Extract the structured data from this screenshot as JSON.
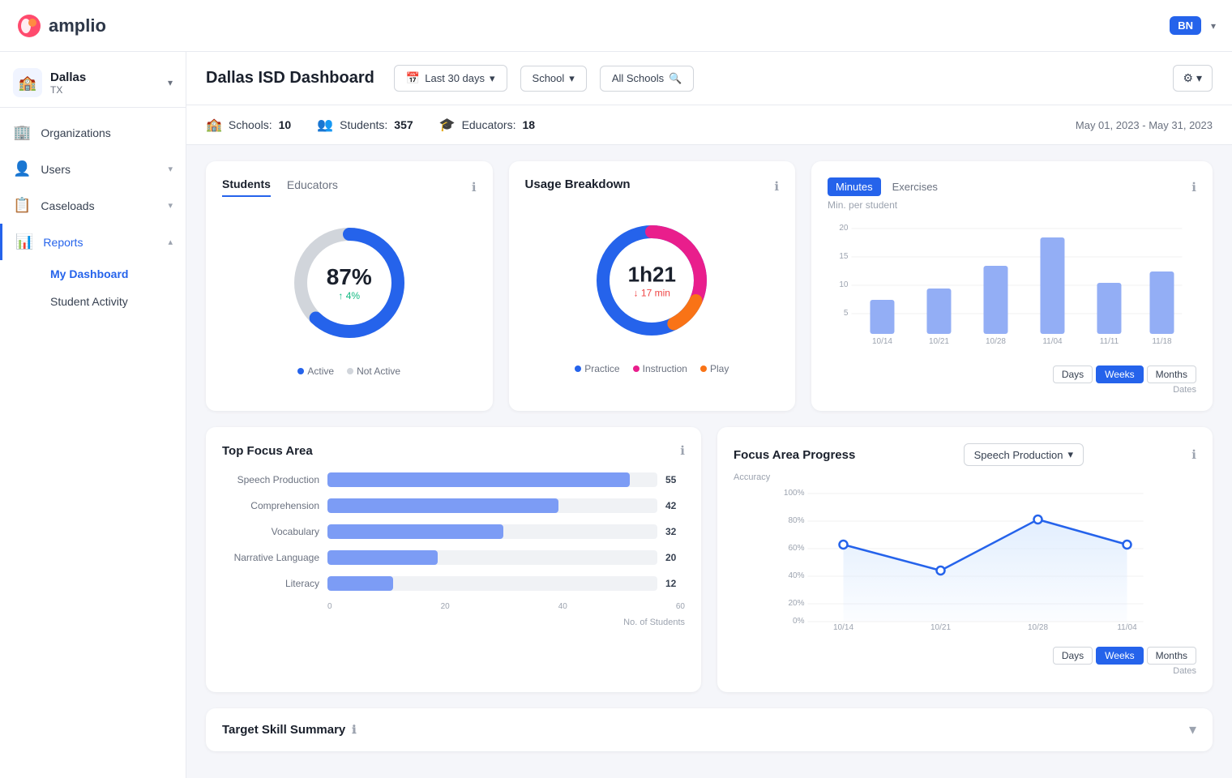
{
  "header": {
    "logo_text": "amplio",
    "user_initials": "BN"
  },
  "sidebar": {
    "district": {
      "name": "Dallas",
      "state": "TX"
    },
    "nav_items": [
      {
        "id": "organizations",
        "label": "Organizations",
        "icon": "🏢",
        "active": false
      },
      {
        "id": "users",
        "label": "Users",
        "icon": "👤",
        "has_sub": true,
        "active": false
      },
      {
        "id": "caseloads",
        "label": "Caseloads",
        "icon": "📋",
        "has_sub": true,
        "active": false
      },
      {
        "id": "reports",
        "label": "Reports",
        "icon": "📊",
        "has_sub": true,
        "active": true
      }
    ],
    "reports_sub": [
      {
        "id": "my-dashboard",
        "label": "My Dashboard",
        "active": true
      },
      {
        "id": "student-activity",
        "label": "Student Activity",
        "active": false
      }
    ]
  },
  "dashboard": {
    "title": "Dallas ISD Dashboard",
    "date_filter": "Last 30 days",
    "school_filter": "School",
    "school_search": "All Schools",
    "stats": {
      "schools_label": "Schools:",
      "schools_value": "10",
      "students_label": "Students:",
      "students_value": "357",
      "educators_label": "Educators:",
      "educators_value": "18",
      "date_range": "May 01, 2023 - May 31, 2023"
    }
  },
  "students_card": {
    "tab_students": "Students",
    "tab_educators": "Educators",
    "percentage": "87%",
    "change": "↑ 4%",
    "change_type": "up",
    "legend_active": "Active",
    "legend_not_active": "Not Active",
    "active_color": "#2563eb",
    "not_active_color": "#d1d5db"
  },
  "usage_card": {
    "title": "Usage Breakdown",
    "time": "1h21",
    "change": "↓ 17 min",
    "legend_practice": "Practice",
    "legend_instruction": "Instruction",
    "legend_play": "Play",
    "practice_color": "#2563eb",
    "instruction_color": "#e91e8c",
    "play_color": "#f97316"
  },
  "bar_chart": {
    "title": "Min. per student",
    "tab_minutes": "Minutes",
    "tab_exercises": "Exercises",
    "bars": [
      {
        "label": "10/14",
        "value": 6
      },
      {
        "label": "10/21",
        "value": 8
      },
      {
        "label": "10/28",
        "value": 12
      },
      {
        "label": "11/04",
        "value": 17
      },
      {
        "label": "11/11",
        "value": 9
      },
      {
        "label": "11/18",
        "value": 11
      }
    ],
    "max_value": 20,
    "y_labels": [
      "20",
      "15",
      "10",
      "5"
    ],
    "ctrl_days": "Days",
    "ctrl_weeks": "Weeks",
    "ctrl_months": "Months",
    "active_ctrl": "Weeks",
    "dates_label": "Dates"
  },
  "focus_area": {
    "title": "Top Focus Area",
    "bars": [
      {
        "label": "Speech Production",
        "value": 55,
        "max": 60
      },
      {
        "label": "Comprehension",
        "value": 42,
        "max": 60
      },
      {
        "label": "Vocabulary",
        "value": 32,
        "max": 60
      },
      {
        "label": "Narrative Language",
        "value": 20,
        "max": 60
      },
      {
        "label": "Literacy",
        "value": 12,
        "max": 60
      }
    ],
    "axis_labels": [
      "0",
      "20",
      "40",
      "60"
    ],
    "axis_title": "No. of Students"
  },
  "progress_card": {
    "title": "Focus Area Progress",
    "dropdown": "Speech Production",
    "y_labels": [
      "100%",
      "80%",
      "60%",
      "40%",
      "20%",
      "0%"
    ],
    "y_axis_title": "Accuracy",
    "x_labels": [
      "10/14",
      "10/21",
      "10/28",
      "11/04"
    ],
    "dates_label": "Dates",
    "line_points": [
      {
        "x": 0,
        "y": 60
      },
      {
        "x": 1,
        "y": 40
      },
      {
        "x": 2,
        "y": 80
      },
      {
        "x": 3,
        "y": 60
      }
    ],
    "ctrl_days": "Days",
    "ctrl_weeks": "Weeks",
    "ctrl_months": "Months",
    "active_ctrl": "Weeks"
  },
  "target_skill": {
    "title": "Target Skill Summary",
    "info_icon": "ℹ"
  }
}
